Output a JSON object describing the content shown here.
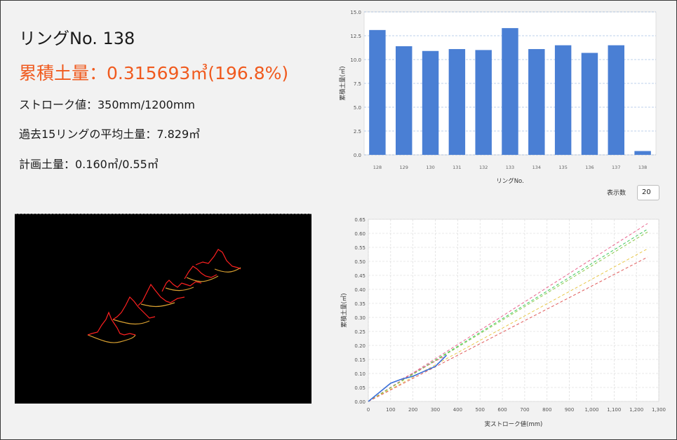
{
  "info": {
    "ring_title": "リングNo. 138",
    "volume": "累積土量：0.315693㎥(196.8%)",
    "stroke": "ストローク値：350mm/1200mm",
    "average": "過去15リングの平均土量：7.829㎥",
    "plan": "計画土量：0.160㎥/0.55㎥"
  },
  "display_count": {
    "label": "表示数",
    "value": "20"
  },
  "colors": {
    "accent_text": "#f05a1e",
    "bar": "#4a7fd4",
    "actual_line": "#3a6fd8"
  },
  "chart_data": [
    {
      "type": "bar",
      "title": "",
      "xlabel": "リングNo.",
      "ylabel": "累積土量(㎥)",
      "categories": [
        "128",
        "129",
        "130",
        "131",
        "132",
        "133",
        "134",
        "135",
        "136",
        "137",
        "138"
      ],
      "values": [
        13.1,
        11.4,
        10.9,
        11.1,
        11.0,
        13.3,
        11.1,
        11.5,
        10.7,
        11.5,
        0.4
      ],
      "ylim": [
        0,
        15
      ],
      "yticks": [
        "0.0",
        "2.5",
        "5.0",
        "7.5",
        "10.0",
        "12.5",
        "15.0"
      ],
      "grid": "horizontal dashed"
    },
    {
      "type": "line",
      "title": "",
      "xlabel": "実ストローク値(mm)",
      "ylabel": "累積土量(㎥)",
      "xlim": [
        0,
        1300
      ],
      "ylim": [
        0,
        0.65
      ],
      "xticks": [
        "0",
        "100",
        "200",
        "300",
        "400",
        "500",
        "600",
        "700",
        "800",
        "900",
        "1,000",
        "1,100",
        "1,200",
        "1,300"
      ],
      "yticks": [
        "0.00",
        "0.05",
        "0.10",
        "0.15",
        "0.20",
        "0.25",
        "0.30",
        "0.35",
        "0.40",
        "0.45",
        "0.50",
        "0.55",
        "0.60",
        "0.65"
      ],
      "grid": "both dashed",
      "series": [
        {
          "color": "#3a6fd8",
          "style": "solid",
          "points": [
            [
              0,
              0
            ],
            [
              100,
              0.065
            ],
            [
              150,
              0.08
            ],
            [
              200,
              0.09
            ],
            [
              300,
              0.125
            ],
            [
              350,
              0.165
            ]
          ]
        },
        {
          "color": "#e8628c",
          "style": "dashed",
          "points": [
            [
              0,
              0
            ],
            [
              1250,
              0.635
            ]
          ]
        },
        {
          "color": "#3cc85a",
          "style": "dashed",
          "points": [
            [
              0,
              0
            ],
            [
              1250,
              0.615
            ]
          ]
        },
        {
          "color": "#8cc84a",
          "style": "dashed",
          "points": [
            [
              0,
              0
            ],
            [
              1250,
              0.605
            ]
          ]
        },
        {
          "color": "#e8c84a",
          "style": "dashed",
          "points": [
            [
              0,
              0
            ],
            [
              1250,
              0.545
            ]
          ]
        },
        {
          "color": "#e05a5a",
          "style": "dashed",
          "points": [
            [
              0,
              0
            ],
            [
              1250,
              0.515
            ]
          ]
        },
        {
          "color": "#e8628c",
          "style": "dashed",
          "points": [
            [
              150,
              0.08
            ],
            [
              350,
              0.165
            ]
          ]
        }
      ]
    }
  ]
}
